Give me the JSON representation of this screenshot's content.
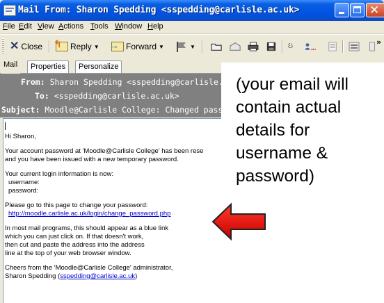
{
  "window": {
    "title": "Mail From: Sharon Spedding <sspedding@carlisle.ac.uk>"
  },
  "menu": [
    {
      "accel": "F",
      "rest": "ile"
    },
    {
      "accel": "E",
      "rest": "dit"
    },
    {
      "accel": "V",
      "rest": "iew"
    },
    {
      "accel": "A",
      "rest": "ctions"
    },
    {
      "accel": "T",
      "rest": "ools"
    },
    {
      "accel": "W",
      "rest": "indow"
    },
    {
      "accel": "H",
      "rest": "elp"
    }
  ],
  "toolbar": {
    "close": "Close",
    "reply": "Reply",
    "forward": "Forward",
    "overflow": "»"
  },
  "tabs": [
    "Mail",
    "Properties",
    "Personalize"
  ],
  "header": {
    "from_label": "From:",
    "from_value": "Sharon Spedding <sspedding@carlisle.ac.uk>",
    "to_label": "To:",
    "to_value": "<sspedding@carlisle.ac.uk>",
    "subject_label": "Subject:",
    "subject_value": "Moodle@Carlisle College: Changed password"
  },
  "body": {
    "greeting": "Hi Sharon,",
    "para1_line1": "Your account password at 'Moodle@Carlisle College' has been rese",
    "para1_line2": "and you have been issued with a new temporary password.",
    "para2_line1": "Your current login information is now:",
    "username_label": "username:",
    "password_label": "password:",
    "para3_line1": "Please go to this page to change your password:",
    "change_link": "http://moodle.carlisle.ac.uk/login/change_password.php",
    "para4_line1": "In most mail programs, this should appear as a blue link",
    "para4_line2": "which you can just click on.  If that doesn't work,",
    "para4_line3": "then cut and paste the address into the address",
    "para4_line4": "line at the top of your web browser window.",
    "sign_line1": "Cheers from the 'Moodle@Carlisle College' administrator,",
    "sign_name": "Sharon Spedding (",
    "sign_email": "sspedding@carlisle.ac.uk",
    "sign_close": ")"
  },
  "annotation": {
    "lines": [
      "(your email will",
      "contain actual",
      "details for",
      "username &",
      "password)"
    ],
    "arrow_color": "#ee1111"
  }
}
